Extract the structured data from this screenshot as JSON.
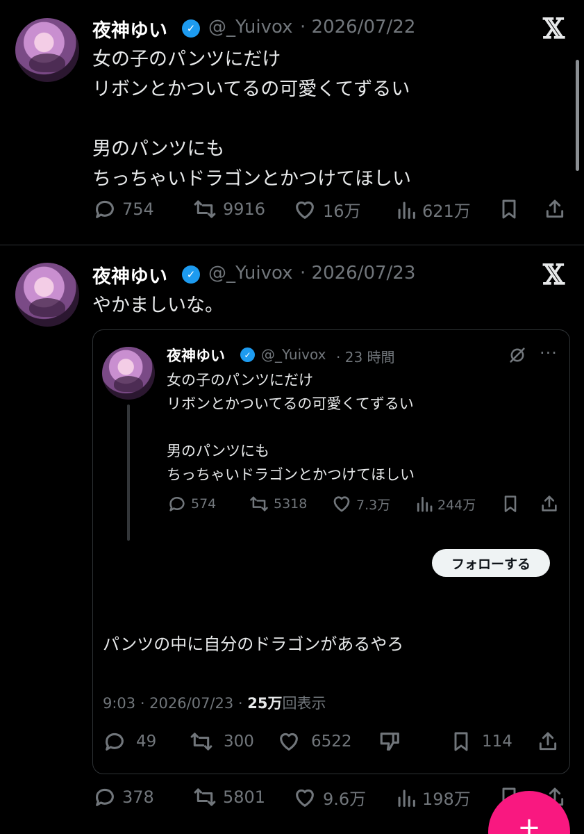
{
  "tweet1": {
    "name": "夜神ゆい",
    "handle": "@_Yuivox",
    "date": "· 2026/07/22",
    "text": "女の子のパンツにだけ\nリボンとかついてるの可愛くてずるい\n\n男のパンツにも\nちっちゃいドラゴンとかつけてほしい",
    "replies": "754",
    "retweets": "9916",
    "likes": "16万",
    "views": "621万"
  },
  "tweet2": {
    "name": "夜神ゆい",
    "handle": "@_Yuivox",
    "date": "· 2026/07/23",
    "text": "やかましいな。",
    "replies": "378",
    "retweets": "5801",
    "likes": "9.6万",
    "views": "198万"
  },
  "quoted": {
    "name": "夜神ゆい",
    "handle": "@_Yuivox",
    "time": "· 23 時間",
    "text": "女の子のパンツにだけ\nリボンとかついてるの可愛くてずるい\n\n男のパンツにも\nちっちゃいドラゴンとかつけてほしい",
    "replies": "574",
    "retweets": "5318",
    "likes": "7.3万",
    "views": "244万",
    "follow_label": "フォローする"
  },
  "reply": {
    "text": "パンツの中に自分のドラゴンがあるやろ",
    "time_date": "9:03 · 2026/07/23 · ",
    "view_count": "25万",
    "view_suffix": "回表示",
    "replies": "49",
    "retweets": "300",
    "likes": "6522",
    "bookmarks": "114"
  },
  "colors": {
    "background": "#000000",
    "accent_blue": "#1d9bf0",
    "fab_pink": "#f91880"
  },
  "icons": [
    "x-logo-icon",
    "verified-badge-icon",
    "reply-icon",
    "retweet-icon",
    "like-icon",
    "views-icon",
    "bookmark-icon",
    "share-icon",
    "grok-icon",
    "more-icon",
    "dislike-icon",
    "compose-icon"
  ]
}
